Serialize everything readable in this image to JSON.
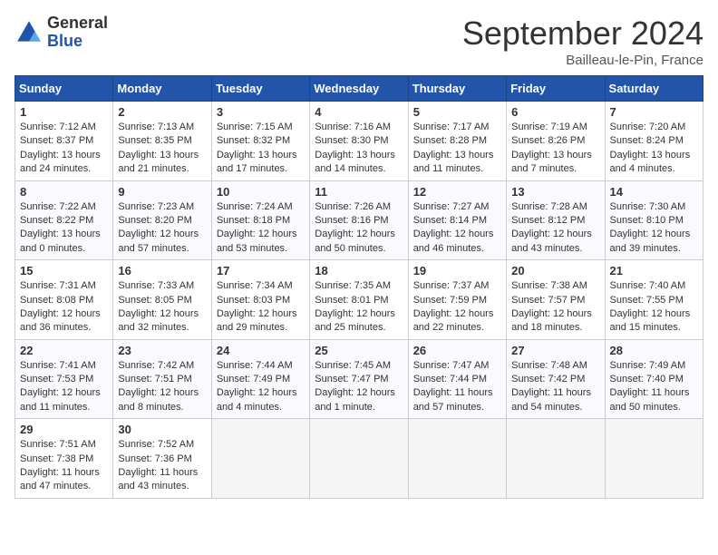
{
  "logo": {
    "general": "General",
    "blue": "Blue"
  },
  "title": "September 2024",
  "subtitle": "Bailleau-le-Pin, France",
  "weekdays": [
    "Sunday",
    "Monday",
    "Tuesday",
    "Wednesday",
    "Thursday",
    "Friday",
    "Saturday"
  ],
  "weeks": [
    [
      {
        "day": 1,
        "info": "Sunrise: 7:12 AM\nSunset: 8:37 PM\nDaylight: 13 hours\nand 24 minutes."
      },
      {
        "day": 2,
        "info": "Sunrise: 7:13 AM\nSunset: 8:35 PM\nDaylight: 13 hours\nand 21 minutes."
      },
      {
        "day": 3,
        "info": "Sunrise: 7:15 AM\nSunset: 8:32 PM\nDaylight: 13 hours\nand 17 minutes."
      },
      {
        "day": 4,
        "info": "Sunrise: 7:16 AM\nSunset: 8:30 PM\nDaylight: 13 hours\nand 14 minutes."
      },
      {
        "day": 5,
        "info": "Sunrise: 7:17 AM\nSunset: 8:28 PM\nDaylight: 13 hours\nand 11 minutes."
      },
      {
        "day": 6,
        "info": "Sunrise: 7:19 AM\nSunset: 8:26 PM\nDaylight: 13 hours\nand 7 minutes."
      },
      {
        "day": 7,
        "info": "Sunrise: 7:20 AM\nSunset: 8:24 PM\nDaylight: 13 hours\nand 4 minutes."
      }
    ],
    [
      {
        "day": 8,
        "info": "Sunrise: 7:22 AM\nSunset: 8:22 PM\nDaylight: 13 hours\nand 0 minutes."
      },
      {
        "day": 9,
        "info": "Sunrise: 7:23 AM\nSunset: 8:20 PM\nDaylight: 12 hours\nand 57 minutes."
      },
      {
        "day": 10,
        "info": "Sunrise: 7:24 AM\nSunset: 8:18 PM\nDaylight: 12 hours\nand 53 minutes."
      },
      {
        "day": 11,
        "info": "Sunrise: 7:26 AM\nSunset: 8:16 PM\nDaylight: 12 hours\nand 50 minutes."
      },
      {
        "day": 12,
        "info": "Sunrise: 7:27 AM\nSunset: 8:14 PM\nDaylight: 12 hours\nand 46 minutes."
      },
      {
        "day": 13,
        "info": "Sunrise: 7:28 AM\nSunset: 8:12 PM\nDaylight: 12 hours\nand 43 minutes."
      },
      {
        "day": 14,
        "info": "Sunrise: 7:30 AM\nSunset: 8:10 PM\nDaylight: 12 hours\nand 39 minutes."
      }
    ],
    [
      {
        "day": 15,
        "info": "Sunrise: 7:31 AM\nSunset: 8:08 PM\nDaylight: 12 hours\nand 36 minutes."
      },
      {
        "day": 16,
        "info": "Sunrise: 7:33 AM\nSunset: 8:05 PM\nDaylight: 12 hours\nand 32 minutes."
      },
      {
        "day": 17,
        "info": "Sunrise: 7:34 AM\nSunset: 8:03 PM\nDaylight: 12 hours\nand 29 minutes."
      },
      {
        "day": 18,
        "info": "Sunrise: 7:35 AM\nSunset: 8:01 PM\nDaylight: 12 hours\nand 25 minutes."
      },
      {
        "day": 19,
        "info": "Sunrise: 7:37 AM\nSunset: 7:59 PM\nDaylight: 12 hours\nand 22 minutes."
      },
      {
        "day": 20,
        "info": "Sunrise: 7:38 AM\nSunset: 7:57 PM\nDaylight: 12 hours\nand 18 minutes."
      },
      {
        "day": 21,
        "info": "Sunrise: 7:40 AM\nSunset: 7:55 PM\nDaylight: 12 hours\nand 15 minutes."
      }
    ],
    [
      {
        "day": 22,
        "info": "Sunrise: 7:41 AM\nSunset: 7:53 PM\nDaylight: 12 hours\nand 11 minutes."
      },
      {
        "day": 23,
        "info": "Sunrise: 7:42 AM\nSunset: 7:51 PM\nDaylight: 12 hours\nand 8 minutes."
      },
      {
        "day": 24,
        "info": "Sunrise: 7:44 AM\nSunset: 7:49 PM\nDaylight: 12 hours\nand 4 minutes."
      },
      {
        "day": 25,
        "info": "Sunrise: 7:45 AM\nSunset: 7:47 PM\nDaylight: 12 hours\nand 1 minute."
      },
      {
        "day": 26,
        "info": "Sunrise: 7:47 AM\nSunset: 7:44 PM\nDaylight: 11 hours\nand 57 minutes."
      },
      {
        "day": 27,
        "info": "Sunrise: 7:48 AM\nSunset: 7:42 PM\nDaylight: 11 hours\nand 54 minutes."
      },
      {
        "day": 28,
        "info": "Sunrise: 7:49 AM\nSunset: 7:40 PM\nDaylight: 11 hours\nand 50 minutes."
      }
    ],
    [
      {
        "day": 29,
        "info": "Sunrise: 7:51 AM\nSunset: 7:38 PM\nDaylight: 11 hours\nand 47 minutes."
      },
      {
        "day": 30,
        "info": "Sunrise: 7:52 AM\nSunset: 7:36 PM\nDaylight: 11 hours\nand 43 minutes."
      },
      null,
      null,
      null,
      null,
      null
    ]
  ]
}
